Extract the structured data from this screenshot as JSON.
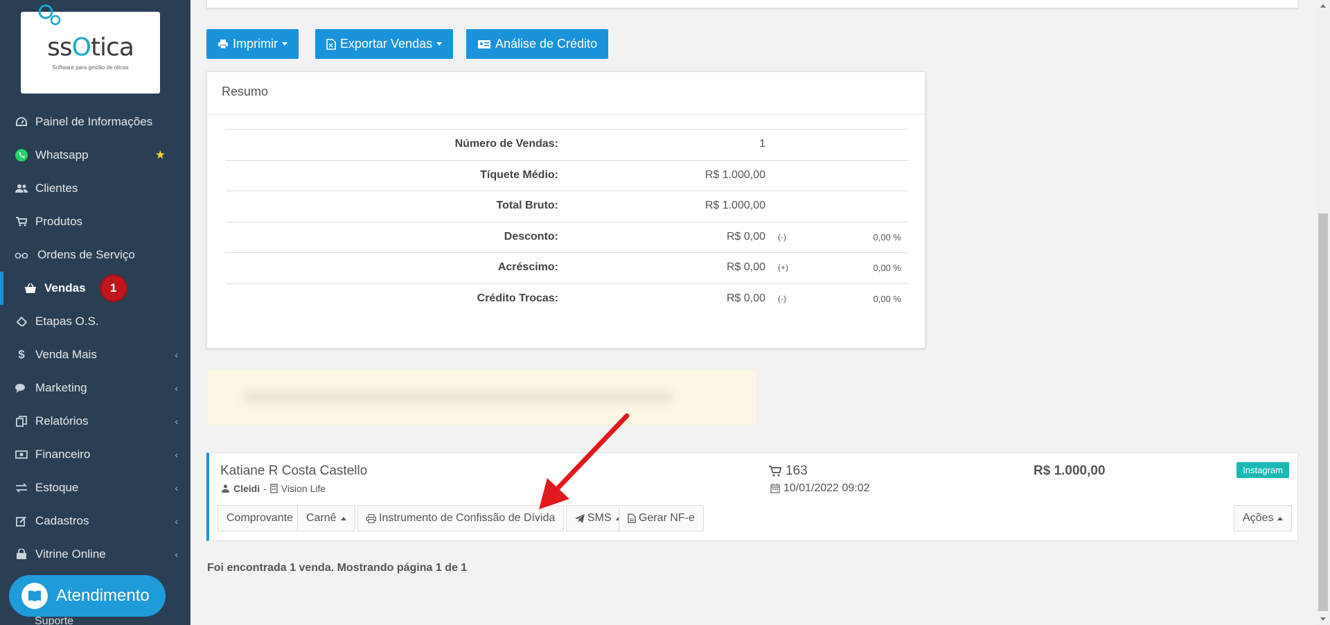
{
  "app": {
    "logo_text_pre": "ss",
    "logo_text_o": "O",
    "logo_text_post": "tica",
    "logo_tagline": "Software para gestão de óticas"
  },
  "sidebar": {
    "items": [
      {
        "label": "Painel de Informações",
        "icon": "dashboard-icon"
      },
      {
        "label": "Whatsapp",
        "icon": "whatsapp-icon"
      },
      {
        "label": "Clientes",
        "icon": "users-icon"
      },
      {
        "label": "Produtos",
        "icon": "cart-icon"
      },
      {
        "label": "Ordens de Serviço",
        "icon": "glasses-icon"
      },
      {
        "label": "Vendas",
        "icon": "basket-icon",
        "badge": "1"
      },
      {
        "label": "Etapas O.S.",
        "icon": "ticket-icon"
      },
      {
        "label": "Venda Mais",
        "icon": "dollar-icon"
      },
      {
        "label": "Marketing",
        "icon": "chat-icon"
      },
      {
        "label": "Relatórios",
        "icon": "copy-icon"
      },
      {
        "label": "Financeiro",
        "icon": "money-icon"
      },
      {
        "label": "Estoque",
        "icon": "exchange-icon"
      },
      {
        "label": "Cadastros",
        "icon": "edit-icon"
      },
      {
        "label": "Vitrine Online",
        "icon": "store-icon"
      }
    ],
    "suporte_label": "Suporte",
    "atendimento_label": "Atendimento"
  },
  "toolbar": {
    "imprimir": "Imprimir",
    "exportar": "Exportar Vendas",
    "analise": "Análise de Crédito"
  },
  "resumo": {
    "title": "Resumo",
    "rows": [
      {
        "label": "Número de Vendas:",
        "value": "1",
        "sign": "",
        "pct": ""
      },
      {
        "label": "Tíquete Médio:",
        "value": "R$ 1.000,00",
        "sign": "",
        "pct": ""
      },
      {
        "label": "Total Bruto:",
        "value": "R$ 1.000,00",
        "sign": "",
        "pct": ""
      },
      {
        "label": "Desconto:",
        "value": "R$ 0,00",
        "sign": "(-)",
        "pct": "0,00 %"
      },
      {
        "label": "Acréscimo:",
        "value": "R$ 0,00",
        "sign": "(+)",
        "pct": "0,00 %"
      },
      {
        "label": "Crédito Trocas:",
        "value": "R$ 0,00",
        "sign": "(-)",
        "pct": "0,00 %"
      }
    ]
  },
  "venda": {
    "cliente": "Katiane R Costa Castello",
    "vendedor": "Cleidi",
    "loja": "Vision Life",
    "numero": "163",
    "data": "10/01/2022 09:02",
    "total": "R$ 1.000,00",
    "origem": "Instagram",
    "buttons": {
      "comprovante": "Comprovante",
      "carne": "Carnê",
      "instrumento": "Instrumento de Confissão de Dívida",
      "sms": "SMS",
      "nfe": "Gerar NF-e",
      "acoes": "Ações"
    }
  },
  "footer": {
    "result_text": "Foi encontrada 1 venda. Mostrando página 1 de 1"
  },
  "colors": {
    "sidebar_bg": "#2a3f54",
    "primary": "#1a93db",
    "badge_red": "#c0151c",
    "tag_teal": "#1bb9b2",
    "arrow_red": "#e0191f"
  }
}
